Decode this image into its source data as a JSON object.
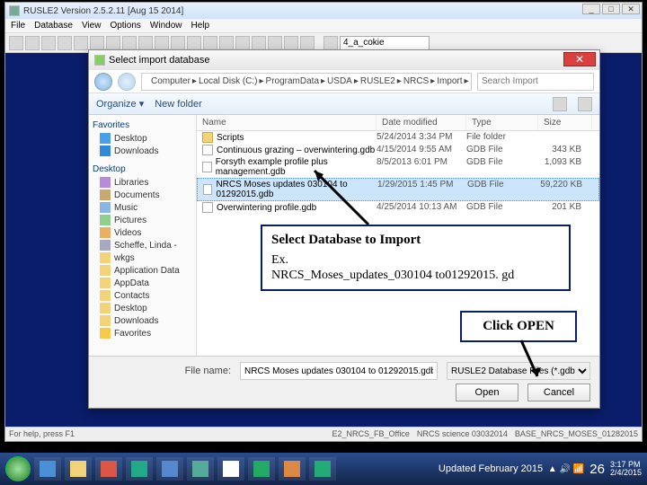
{
  "app": {
    "title": "RUSLE2 Version 2.5.2.11 [Aug 15 2014]",
    "menu": [
      "File",
      "Database",
      "View",
      "Options",
      "Window",
      "Help"
    ],
    "toolbar_input": "4_a_cokie",
    "status_left": "For help, press F1",
    "status_right": [
      "E2_NRCS_FB_Office",
      "NRCS science 03032014",
      "BASE_NRCS_MOSES_01282015"
    ]
  },
  "dialog": {
    "title": "Select import database",
    "close": "✕",
    "nav_back": "◄",
    "nav_fwd": "►",
    "breadcrumb": [
      "Computer",
      "Local Disk (C:)",
      "ProgramData",
      "USDA",
      "RUSLE2",
      "NRCS",
      "Import"
    ],
    "search_placeholder": "Search Import",
    "organize": "Organize ▾",
    "newfolder": "New folder",
    "columns": {
      "name": "Name",
      "date": "Date modified",
      "type": "Type",
      "size": "Size"
    },
    "rows": [
      {
        "icon": "folder",
        "name": "Scripts",
        "date": "5/24/2014 3:34 PM",
        "type": "File folder",
        "size": ""
      },
      {
        "icon": "gdb",
        "name": "Continuous grazing – overwintering.gdb",
        "date": "4/15/2014 9:55 AM",
        "type": "GDB File",
        "size": "343 KB"
      },
      {
        "icon": "gdb",
        "name": "Forsyth example profile plus management.gdb",
        "date": "8/5/2013 6:01 PM",
        "type": "GDB File",
        "size": "1,093 KB"
      },
      {
        "icon": "gdb",
        "name": "NRCS Moses updates 030104 to 01292015.gdb",
        "date": "1/29/2015 1:45 PM",
        "type": "GDB File",
        "size": "59,220 KB",
        "selected": true
      },
      {
        "icon": "gdb",
        "name": "Overwintering profile.gdb",
        "date": "4/25/2014 10:13 AM",
        "type": "GDB File",
        "size": "201 KB"
      }
    ],
    "sidebar": {
      "favorites": "Favorites",
      "items_fav": [
        "Desktop",
        "Downloads"
      ],
      "desktop": "Desktop",
      "libraries": "Libraries",
      "libs": [
        "Documents",
        "Music",
        "Pictures",
        "Videos"
      ],
      "user": "Scheffe, Linda -",
      "user_items": [
        "wkgs",
        "Application Data",
        "AppData",
        "Contacts",
        "Desktop",
        "Downloads",
        "Favorites"
      ]
    },
    "filename_label": "File name:",
    "filename": "NRCS Moses updates 030104 to 01292015.gdb",
    "filetype_label": "RUSLE2 Database Files (*.gdb)",
    "open": "Open",
    "cancel": "Cancel"
  },
  "callouts": {
    "c1_line1": "Select Database to Import",
    "c1_line2": "Ex.",
    "c1_line3": "NRCS_Moses_updates_030104 to01292015. gd",
    "c2": "Click OPEN"
  },
  "taskbar": {
    "center_text": "Updated February 2015",
    "page": "26",
    "time": "3:17 PM",
    "date": "2/4/2015"
  }
}
